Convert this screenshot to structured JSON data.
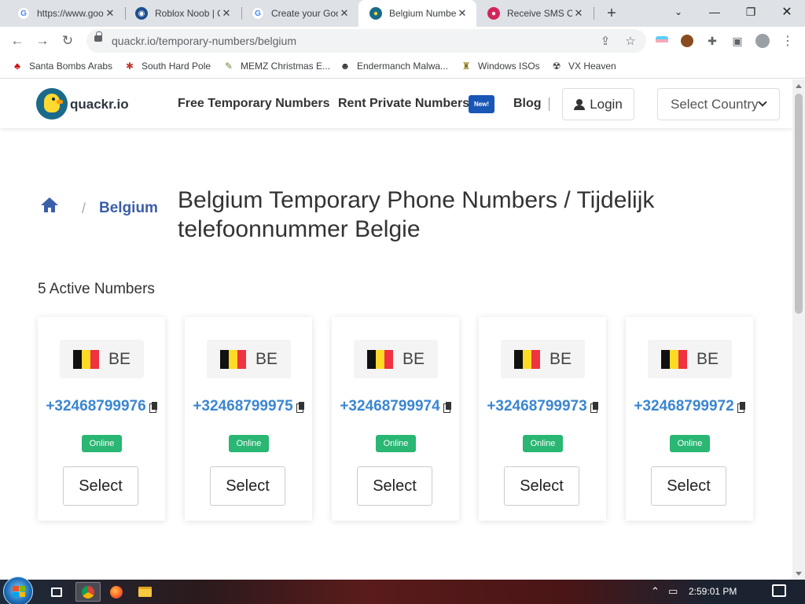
{
  "browser": {
    "tabs": [
      {
        "title": "https://www.goo",
        "favicon": "google-icon"
      },
      {
        "title": "Roblox Noob | C",
        "favicon": "roblox-icon"
      },
      {
        "title": "Create your Goo",
        "favicon": "google-icon"
      },
      {
        "title": "Belgium Numbe",
        "favicon": "quackr-icon",
        "active": true
      },
      {
        "title": "Receive SMS Or",
        "favicon": "sms-icon"
      }
    ],
    "url": "quackr.io/temporary-numbers/belgium",
    "bookmarks": [
      {
        "label": "Santa Bombs Arabs",
        "icon": "santa-icon"
      },
      {
        "label": "South Hard Pole",
        "icon": "snowflake-icon"
      },
      {
        "label": "MEMZ Christmas E...",
        "icon": "memz-icon"
      },
      {
        "label": "Endermanch Malwa...",
        "icon": "endermanch-icon"
      },
      {
        "label": "Windows ISOs",
        "icon": "windows-iso-icon"
      },
      {
        "label": "VX Heaven",
        "icon": "vx-heaven-icon"
      }
    ]
  },
  "site": {
    "brand": "quackr.io",
    "nav": {
      "free": "Free Temporary Numbers",
      "rent": "Rent Private Numbers",
      "new_badge": "New!",
      "blog": "Blog",
      "login": "Login",
      "select_country": "Select Country"
    },
    "breadcrumb": {
      "current": "Belgium"
    },
    "title": "Belgium Temporary Phone Numbers / Tijdelijk telefoonnummer Belgie",
    "active_count": "5 Active Numbers",
    "numbers": [
      {
        "country": "BE",
        "number": "+32468799976",
        "status": "Online",
        "action": "Select"
      },
      {
        "country": "BE",
        "number": "+32468799975",
        "status": "Online",
        "action": "Select"
      },
      {
        "country": "BE",
        "number": "+32468799974",
        "status": "Online",
        "action": "Select"
      },
      {
        "country": "BE",
        "number": "+32468799973",
        "status": "Online",
        "action": "Select"
      },
      {
        "country": "BE",
        "number": "+32468799972",
        "status": "Online",
        "action": "Select"
      }
    ],
    "colors": {
      "accent": "#3b5fa8",
      "number": "#3b86d1",
      "online": "#2ab673",
      "badge": "#1a56b5"
    }
  },
  "taskbar": {
    "clock": "2:59:01 PM"
  }
}
